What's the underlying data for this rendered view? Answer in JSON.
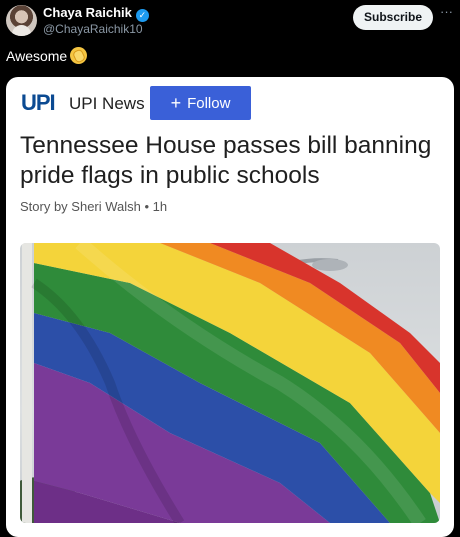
{
  "tweet": {
    "author_name": "Chaya Raichik",
    "handle": "@ChayaRaichik10",
    "subscribe_label": "Subscribe",
    "more_label": "···",
    "text": "Awesome"
  },
  "card": {
    "logo_text": "UPI",
    "outlet_name": "UPI News",
    "follow_plus": "+",
    "follow_label": "Follow",
    "headline": "Tennessee House passes bill banning pride flags in public schools",
    "byline": "Story by Sheri Walsh • 1h"
  },
  "colors": {
    "follow_button": "#3a60d8",
    "verified_badge": "#1d9bf0",
    "upi_blue": "#0b4a92"
  },
  "icons": [
    "verified-badge-icon",
    "clapping-hands-emoji-icon",
    "more-options-icon",
    "plus-icon"
  ]
}
